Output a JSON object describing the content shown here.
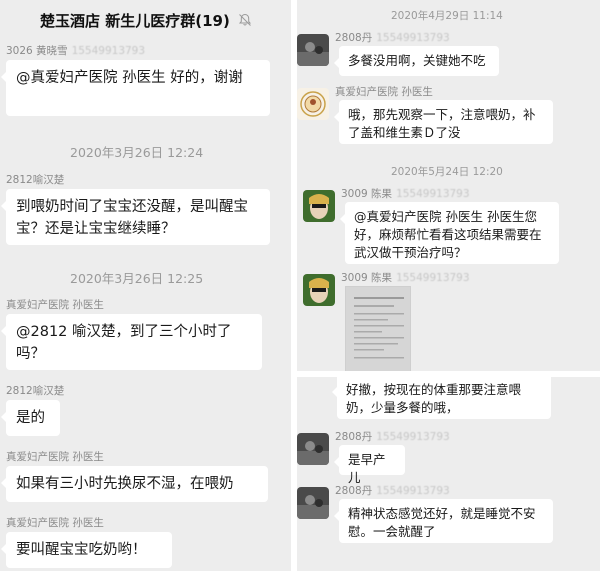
{
  "left": {
    "header_title": "楚玉酒店 新生儿医疗群(19)",
    "messages": [
      {
        "sender": "3026 黄晓雪",
        "phone": "15549913793",
        "text": "@真爱妇产医院 孙医生  好的，谢谢"
      },
      {
        "timestamp": "2020年3月26日 12:24"
      },
      {
        "sender": "2812喻汉楚",
        "text": "到喂奶时间了宝宝还没醒，是叫醒宝宝？还是让宝宝继续睡？"
      },
      {
        "timestamp": "2020年3月26日 12:25"
      },
      {
        "sender": "真爱妇产医院 孙医生",
        "text": "@2812 喻汉楚，到了三个小时了吗？"
      },
      {
        "sender": "2812喻汉楚",
        "text": "是的"
      },
      {
        "sender": "真爱妇产医院 孙医生",
        "text": "如果有三小时先换尿不湿，在喂奶"
      },
      {
        "sender": "真爱妇产医院 孙医生",
        "text": "要叫醒宝宝吃奶哟！"
      }
    ]
  },
  "right_top": {
    "timestamp1": "2020年4月29日 11:14",
    "m1": {
      "sender": "2808丹",
      "phone": "15549913793",
      "text": "多餐没用啊，关键她不吃"
    },
    "m2": {
      "sender": "真爱妇产医院 孙医生",
      "text": "哦，那先观察一下，注意喂奶，补了盖和维生素Ｄ了没"
    },
    "timestamp2": "2020年5月24日 12:20",
    "m3": {
      "sender": "3009 陈果",
      "phone": "15549913793",
      "text": "@真爱妇产医院 孙医生 孙医生您好，麻烦帮忙看看这项结果需要在武汉做干预治疗吗？"
    },
    "m4": {
      "sender": "3009 陈果",
      "phone": "15549913793"
    }
  },
  "right_bottom": {
    "m1": {
      "text": "好撤，按现在的体重那要注意喂奶，少量多餐的哦，"
    },
    "m2": {
      "sender": "2808丹",
      "phone": "15549913793",
      "text": "是早产儿"
    },
    "m3": {
      "sender": "2808丹",
      "phone": "15549913793",
      "text": "精神状态感觉还好，就是睡觉不安慰。一会就醒了"
    }
  },
  "colors": {
    "chat_bg": "#ededed",
    "bubble_bg": "#ffffff",
    "timestamp": "#9a9a9a",
    "sender": "#8a8a8a"
  },
  "icons": {
    "mute": "muted-bell-icon"
  }
}
